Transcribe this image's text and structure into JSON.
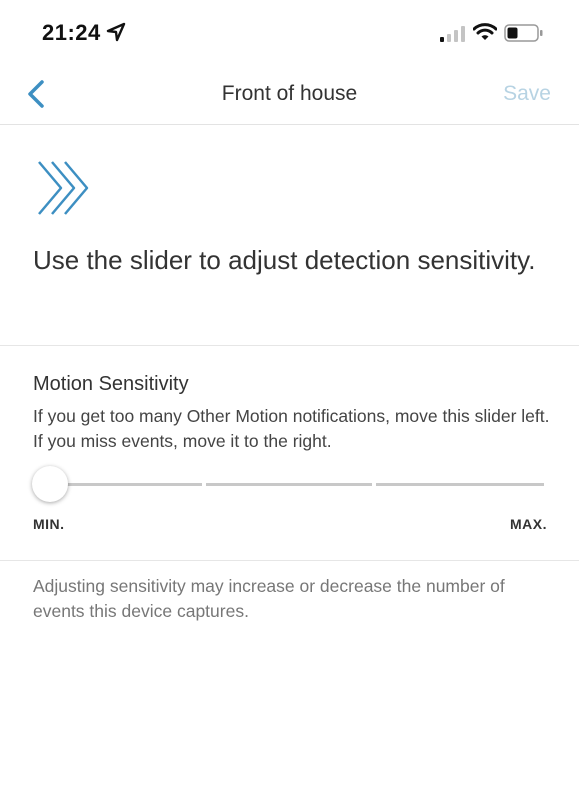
{
  "status_bar": {
    "time": "21:24"
  },
  "nav": {
    "title": "Front of house",
    "save_label": "Save"
  },
  "hero": {
    "text": "Use the slider to adjust detection sensitivity."
  },
  "motion": {
    "title": "Motion Sensitivity",
    "description": "If you get too many Other Motion notifications, move this slider left. If you miss events, move it to the right.",
    "slider": {
      "value": 0,
      "min_label": "MIN.",
      "max_label": "MAX."
    }
  },
  "footnote": "Adjusting sensitivity may increase or decrease the number of events this device captures.",
  "colors": {
    "accent": "#3d8fc2",
    "save_disabled": "#b7d3e3"
  }
}
